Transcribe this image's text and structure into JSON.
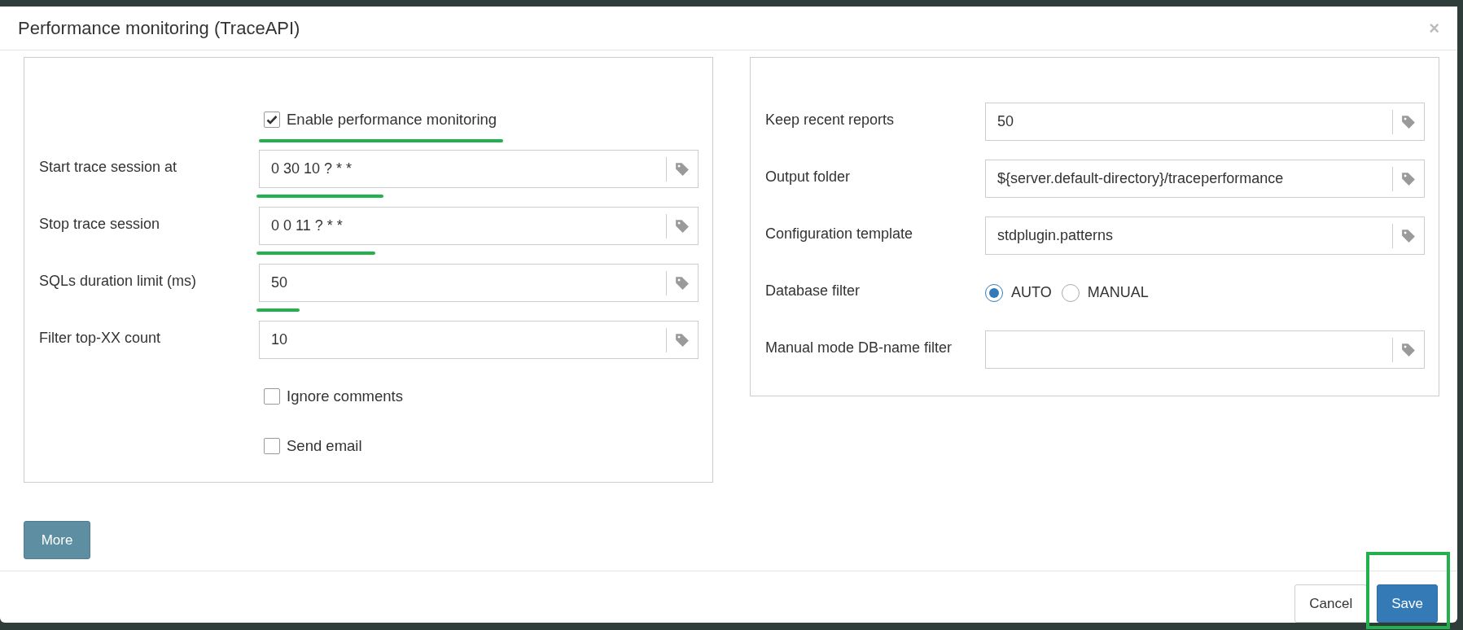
{
  "window": {
    "title": "Performance monitoring (TraceAPI)",
    "close": "×"
  },
  "left_panel": {
    "enable": {
      "label": "Enable performance monitoring",
      "checked": true,
      "underlined": true
    },
    "fields": [
      {
        "label": "Start trace session at",
        "value": "0 30 10 ? * *",
        "underlined": true
      },
      {
        "label": "Stop trace session",
        "value": "0 0 11 ? * *",
        "underlined": true
      },
      {
        "label": "SQLs duration limit (ms)",
        "value": "50",
        "underlined": true
      },
      {
        "label": "Filter top-XX count",
        "value": "10"
      }
    ],
    "checkboxes": [
      {
        "label": "Ignore comments",
        "checked": false
      },
      {
        "label": "Send email",
        "checked": false
      }
    ]
  },
  "right_panel": {
    "fields": [
      {
        "kind": "text",
        "label": "Keep recent reports",
        "value": "50"
      },
      {
        "kind": "text",
        "label": "Output folder",
        "value": "${server.default-directory}/traceperformance"
      },
      {
        "kind": "text",
        "label": "Configuration template",
        "value": "stdplugin.patterns"
      },
      {
        "kind": "radio",
        "label": "Database filter",
        "options": [
          {
            "label": "AUTO",
            "selected": true
          },
          {
            "label": "MANUAL",
            "selected": false
          }
        ]
      },
      {
        "kind": "text",
        "label": "Manual mode DB-name filter"
      }
    ]
  },
  "more_button": "More",
  "footer_buttons": [
    {
      "label": "Cancel",
      "kind": "default"
    },
    {
      "label": "Save",
      "kind": "primary",
      "highlighted": true
    }
  ]
}
